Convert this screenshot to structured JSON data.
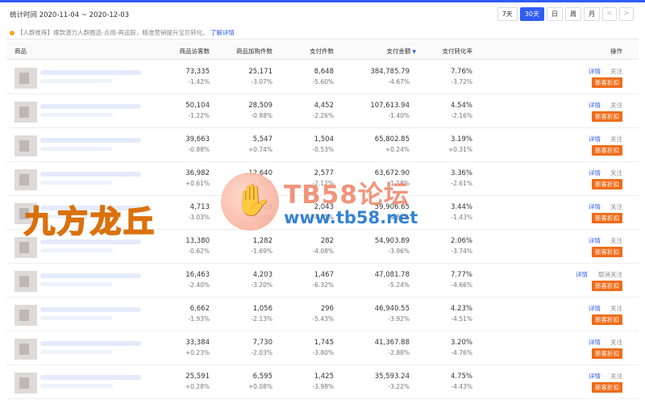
{
  "header": {
    "stat_label": "统计时间 2020-11-04 ~ 2020-12-03",
    "ranges": [
      "7天",
      "30天",
      "日",
      "周",
      "月"
    ],
    "active_range": "30天",
    "prev_icon": "<",
    "next_icon": ">"
  },
  "notice": {
    "text": "【人群推荐】爆款潜力人群圈选-点用-再追踪，精准营销提升宝贝转化。",
    "link": "了解详情"
  },
  "table": {
    "columns": {
      "product": "商品",
      "visitors": "商品访客数",
      "cart": "商品加购件数",
      "pay_items": "支付件数",
      "pay_amount": "支付金额",
      "conv_rate": "支付转化率",
      "actions": "操作"
    },
    "sort_icon": "▼",
    "rows": [
      {
        "visitors": "73,335",
        "visitors_c": "-1.42%",
        "cart": "25,171",
        "cart_c": "-3.07%",
        "items": "8,648",
        "items_c": "-5.60%",
        "amount": "384,785.79",
        "amount_c": "-4.67%",
        "rate": "7.76%",
        "rate_c": "-3.72%",
        "detail": "详情",
        "follow": "关注",
        "discount": "新客折扣"
      },
      {
        "visitors": "50,104",
        "visitors_c": "-1.22%",
        "cart": "28,509",
        "cart_c": "-0.88%",
        "items": "4,452",
        "items_c": "-2.26%",
        "amount": "107,613.94",
        "amount_c": "-1.40%",
        "rate": "4.54%",
        "rate_c": "-2.16%",
        "detail": "详情",
        "follow": "关注",
        "discount": "新客折扣"
      },
      {
        "visitors": "39,663",
        "visitors_c": "-0.88%",
        "cart": "5,547",
        "cart_c": "+0.74%",
        "items": "1,504",
        "items_c": "-0.53%",
        "amount": "65,802.85",
        "amount_c": "+0.24%",
        "rate": "3.19%",
        "rate_c": "+0.31%",
        "detail": "详情",
        "follow": "关注",
        "discount": "新客折扣"
      },
      {
        "visitors": "36,982",
        "visitors_c": "+0.61%",
        "cart": "12,640",
        "cart_c": "-1.52%",
        "items": "2,577",
        "items_c": "-2.12%",
        "amount": "63,672.90",
        "amount_c": "-1.18%",
        "rate": "3.36%",
        "rate_c": "-2.61%",
        "detail": "详情",
        "follow": "关注",
        "discount": "新客折扣"
      },
      {
        "visitors": "4,713",
        "visitors_c": "-3.03%",
        "cart": "7,329",
        "cart_c": "-4.94%",
        "items": "2,043",
        "items_c": "-4.71%",
        "amount": "59,906.65",
        "amount_c": "-4.81%",
        "rate": "3.44%",
        "rate_c": "-1.43%",
        "detail": "详情",
        "follow": "关注",
        "discount": "新客折扣"
      },
      {
        "visitors": "13,380",
        "visitors_c": "-0.62%",
        "cart": "1,282",
        "cart_c": "-1.69%",
        "items": "282",
        "items_c": "-4.08%",
        "amount": "54,903.89",
        "amount_c": "-3.96%",
        "rate": "2.06%",
        "rate_c": "-3.74%",
        "detail": "详情",
        "follow": "关注",
        "discount": "新客折扣"
      },
      {
        "visitors": "16,463",
        "visitors_c": "-2.40%",
        "cart": "4,203",
        "cart_c": "-3.20%",
        "items": "1,467",
        "items_c": "-6.32%",
        "amount": "47,081.78",
        "amount_c": "-5.24%",
        "rate": "7.77%",
        "rate_c": "-4.66%",
        "detail": "详情",
        "follow": "取消关注",
        "discount": "新客折扣"
      },
      {
        "visitors": "6,662",
        "visitors_c": "-1.93%",
        "cart": "1,056",
        "cart_c": "-2.13%",
        "items": "296",
        "items_c": "-5.43%",
        "amount": "46,940.55",
        "amount_c": "-3.92%",
        "rate": "4.23%",
        "rate_c": "-4.51%",
        "detail": "详情",
        "follow": "关注",
        "discount": "新客折扣"
      },
      {
        "visitors": "33,384",
        "visitors_c": "+0.23%",
        "cart": "7,730",
        "cart_c": "-2.03%",
        "items": "1,745",
        "items_c": "-3.80%",
        "amount": "41,367.88",
        "amount_c": "-2.88%",
        "rate": "3.20%",
        "rate_c": "-4.76%",
        "detail": "详情",
        "follow": "关注",
        "discount": "新客折扣"
      },
      {
        "visitors": "25,591",
        "visitors_c": "+0.28%",
        "cart": "6,595",
        "cart_c": "+0.08%",
        "items": "1,425",
        "items_c": "-3.98%",
        "amount": "35,593.24",
        "amount_c": "-3.22%",
        "rate": "4.75%",
        "rate_c": "-4.43%",
        "detail": "详情",
        "follow": "关注",
        "discount": "新客折扣"
      }
    ]
  },
  "watermark": {
    "title": "TB58论坛",
    "url": "www.tb58.net",
    "left_text": "九方龙丘"
  }
}
